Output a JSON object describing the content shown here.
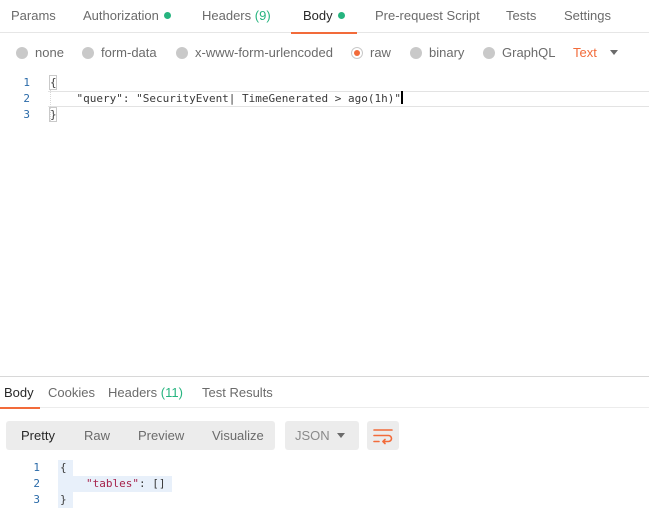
{
  "request_tabs": [
    {
      "label": "Params"
    },
    {
      "label": "Authorization"
    },
    {
      "label": "Headers",
      "count": "(9)"
    },
    {
      "label": "Body"
    },
    {
      "label": "Pre-request Script"
    },
    {
      "label": "Tests"
    },
    {
      "label": "Settings"
    }
  ],
  "active_request_tab": "Body",
  "body_types": [
    {
      "label": "none"
    },
    {
      "label": "form-data"
    },
    {
      "label": "x-www-form-urlencoded"
    },
    {
      "label": "raw"
    },
    {
      "label": "binary"
    },
    {
      "label": "GraphQL"
    }
  ],
  "selected_body_type": "raw",
  "raw_language": "Text",
  "request_body": {
    "line_numbers": [
      "1",
      "2",
      "3"
    ],
    "lines": [
      "{",
      "    \"query\": \"SecurityEvent| TimeGenerated > ago(1h)\"",
      "}"
    ]
  },
  "response_tabs": [
    {
      "label": "Body"
    },
    {
      "label": "Cookies"
    },
    {
      "label": "Headers",
      "count": "(11)"
    },
    {
      "label": "Test Results"
    }
  ],
  "active_response_tab": "Body",
  "view_modes": [
    {
      "label": "Pretty"
    },
    {
      "label": "Raw"
    },
    {
      "label": "Preview"
    },
    {
      "label": "Visualize"
    }
  ],
  "active_view_mode": "Pretty",
  "response_format": "JSON",
  "response_body": {
    "line_numbers": [
      "1",
      "2",
      "3"
    ],
    "open_brace": "{",
    "key": "\"tables\"",
    "separator": ": ",
    "value": "[]",
    "close_brace": "}"
  },
  "colors": {
    "accent": "#f26b3a",
    "status_green": "#26b47f",
    "line_number": "#2a6aa8",
    "json_key": "#a6224b"
  }
}
